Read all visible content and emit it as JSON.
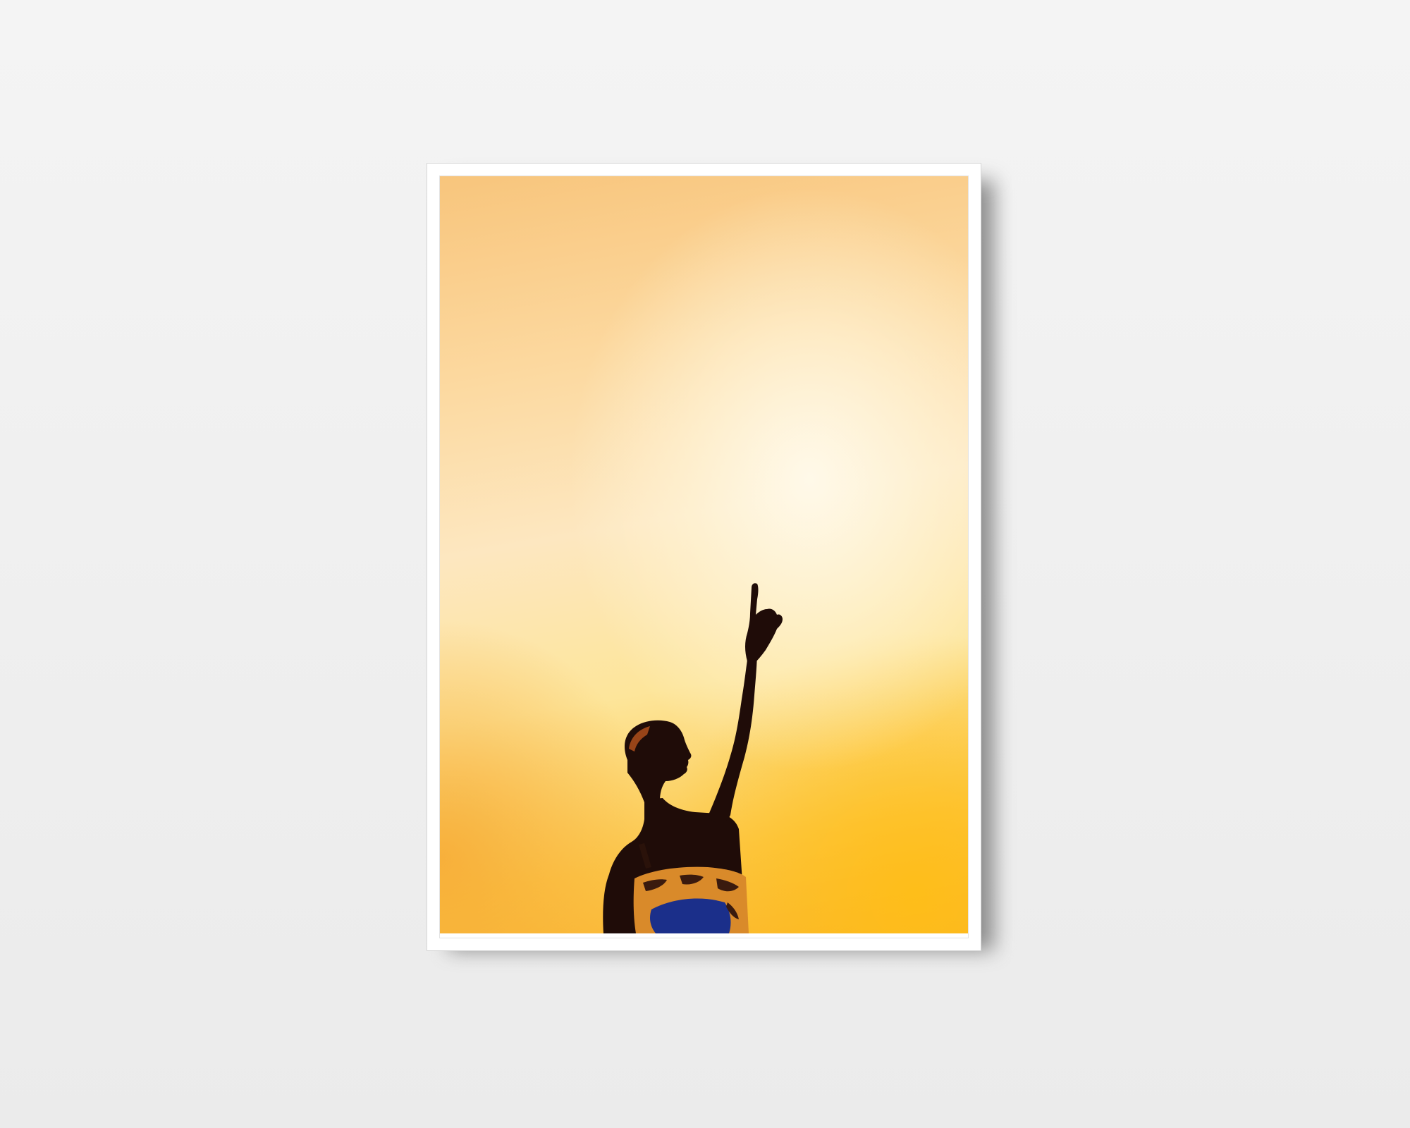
{
  "scene": {
    "subject": "framed-photograph-on-wall",
    "frame_color": "#ffffff",
    "wall_color": "#f0f0f0",
    "sky_colors": [
      "#f8c57c",
      "#fde7c0",
      "#fcc84a",
      "#f9b32d"
    ],
    "silhouette_color": "#1f0c08",
    "fabric_colors": [
      "#d98a2a",
      "#1b2f8a",
      "#3a1a0e"
    ]
  }
}
